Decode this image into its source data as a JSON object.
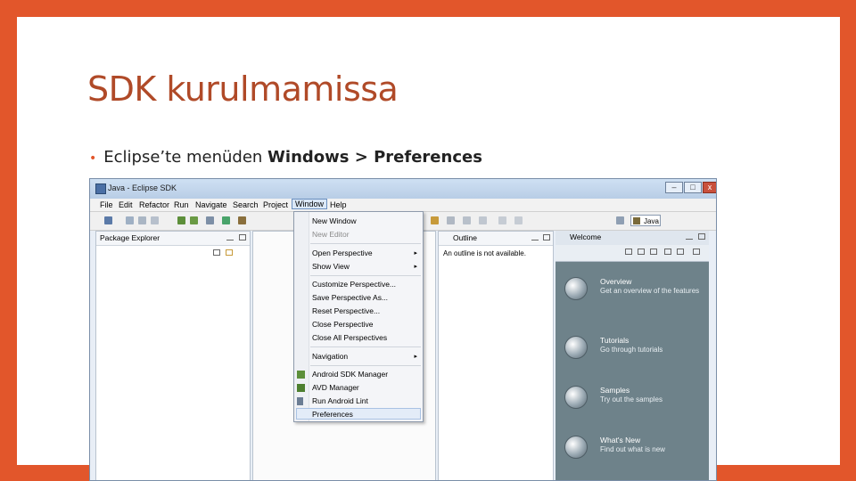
{
  "slide": {
    "title": "SDK kurulmamissa",
    "bullet_prefix": "Eclipse’te menüden ",
    "bullet_bold_1": "Windows",
    "bullet_sep": " > ",
    "bullet_bold_2": "Preferences"
  },
  "window": {
    "title": "Java - Eclipse SDK",
    "min_label": "–",
    "max_label": "□",
    "close_label": "x"
  },
  "menubar": [
    "File",
    "Edit",
    "Refactor",
    "Run",
    "Navigate",
    "Search",
    "Project",
    "Window",
    "Help"
  ],
  "perspective": {
    "label": "Java"
  },
  "panes": {
    "package_explorer": "Package Explorer",
    "outline": "Outline",
    "outline_message": "An outline is not available.",
    "welcome": "Welcome"
  },
  "window_menu": {
    "new_window": "New Window",
    "new_editor": "New Editor",
    "open_perspective": "Open Perspective",
    "show_view": "Show View",
    "customize_perspective": "Customize Perspective...",
    "save_perspective_as": "Save Perspective As...",
    "reset_perspective": "Reset Perspective...",
    "close_perspective": "Close Perspective",
    "close_all_perspectives": "Close All Perspectives",
    "navigation": "Navigation",
    "android_sdk_manager": "Android SDK Manager",
    "avd_manager": "AVD Manager",
    "run_android_lint": "Run Android Lint",
    "preferences": "Preferences",
    "submenu_arrow": "▸"
  },
  "welcome_items": [
    {
      "title": "Overview",
      "desc": "Get an overview of the features"
    },
    {
      "title": "Tutorials",
      "desc": "Go through tutorials"
    },
    {
      "title": "Samples",
      "desc": "Try out the samples"
    },
    {
      "title": "What's New",
      "desc": "Find out what is new"
    }
  ],
  "colors": {
    "slide_border": "#e2562b",
    "title_text": "#b04a28",
    "welcome_bg": "#6e828a"
  }
}
